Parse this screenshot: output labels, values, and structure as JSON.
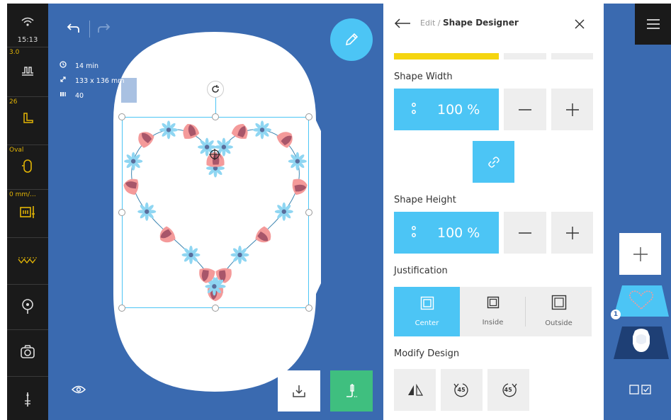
{
  "status": {
    "time": "15:13",
    "item2_value": "3.0",
    "item3_value": "26",
    "item4_value": "Oval",
    "item5_value": "0 mm/..."
  },
  "canvas": {
    "info_time": "14 min",
    "info_size": "133 x 136 mm",
    "info_count": "40"
  },
  "panel": {
    "breadcrumb_prefix": "Edit / ",
    "breadcrumb_current": "Shape Designer",
    "width_label": "Shape Width",
    "width_value": "100 %",
    "height_label": "Shape Height",
    "height_value": "100 %",
    "justification_label": "Justification",
    "justification_options": [
      "Center",
      "Inside",
      "Outside"
    ],
    "modify_label": "Modify Design",
    "rotate_left_label": "45",
    "rotate_right_label": "45"
  },
  "right_bar": {
    "badge_count": "1"
  },
  "colors": {
    "accent_blue": "#4cc5f5",
    "canvas_blue": "#3a6ab0",
    "status_yellow": "#e3b505",
    "progress_yellow": "#f5d50f",
    "pencil_fab": "#4cc5f5",
    "stitch_green": "#3fbf7f"
  }
}
